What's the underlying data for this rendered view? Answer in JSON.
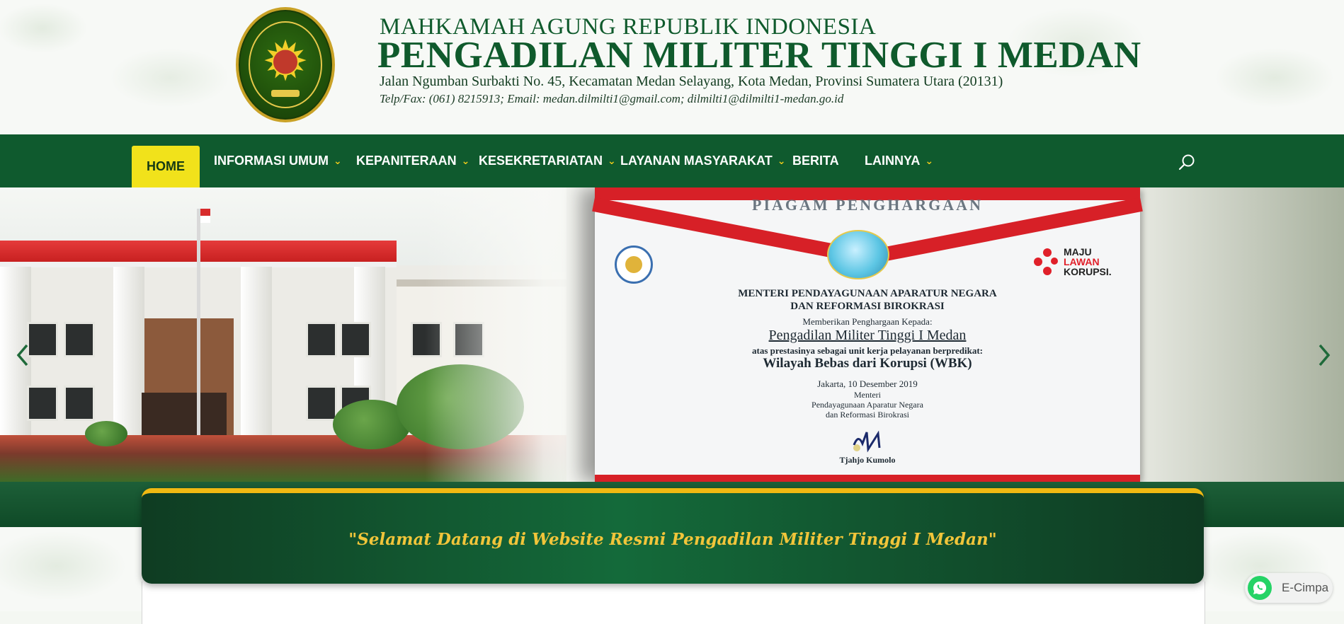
{
  "header": {
    "superTitle": "MAHKAMAH AGUNG REPUBLIK INDONESIA",
    "title": "PENGADILAN MILITER TINGGI I MEDAN",
    "address": "Jalan Ngumban Surbakti No. 45, Kecamatan Medan Selayang, Kota Medan, Provinsi Sumatera Utara (20131)",
    "contact": "Telp/Fax: (061) 8215913; Email: medan.dilmilti1@gmail.com; dilmilti1@dilmilti1-medan.go.id",
    "logo_icon": "court-emblem-icon"
  },
  "nav": {
    "items": [
      {
        "label": "HOME",
        "active": true,
        "dropdown": false
      },
      {
        "label": "INFORMASI UMUM",
        "dropdown": true
      },
      {
        "label": "KEPANITERAAN",
        "dropdown": true
      },
      {
        "label": "KESEKRETARIATAN",
        "dropdown": true
      },
      {
        "label": "LAYANAN MASYARAKAT",
        "dropdown": true
      },
      {
        "label": "BERITA",
        "dropdown": false
      },
      {
        "label": "LAINNYA",
        "dropdown": true
      }
    ],
    "dropdown_glyph": "⌄",
    "search_icon": "search-icon"
  },
  "slider": {
    "certificate": {
      "heading": "PIAGAM PENGHARGAAN",
      "badge_line1": "MAJU",
      "badge_line2": "LAWAN",
      "badge_line3": "KORUPSI.",
      "line1": "MENTERI PENDAYAGUNAAN APARATUR NEGARA",
      "line2": "DAN REFORMASI BIROKRASI",
      "line3": "Memberikan Penghargaan Kepada:",
      "recipient": "Pengadilan Militer Tinggi I Medan",
      "line4": "atas prestasinya sebagai unit kerja pelayanan berpredikat:",
      "award": "Wilayah Bebas dari Korupsi (WBK)",
      "place_date": "Jakarta, 10 Desember 2019",
      "signer_title1": "Menteri",
      "signer_title2": "Pendayagunaan Aparatur Negara",
      "signer_title3": "dan Reformasi Birokrasi",
      "signer_name": "Tjahjo Kumolo"
    },
    "prev_icon": "chevron-left-icon",
    "next_icon": "chevron-right-icon"
  },
  "welcome": {
    "text": "\"Selamat Datang di Website Resmi Pengadilan Militer Tinggi I Medan\""
  },
  "whatsapp": {
    "label": "E-Cimpa",
    "icon": "whatsapp-icon",
    "color": "#25d366"
  },
  "colors": {
    "brand_green": "#0f5a2e",
    "accent_yellow": "#f1e21b",
    "gold": "#f1c53a"
  }
}
